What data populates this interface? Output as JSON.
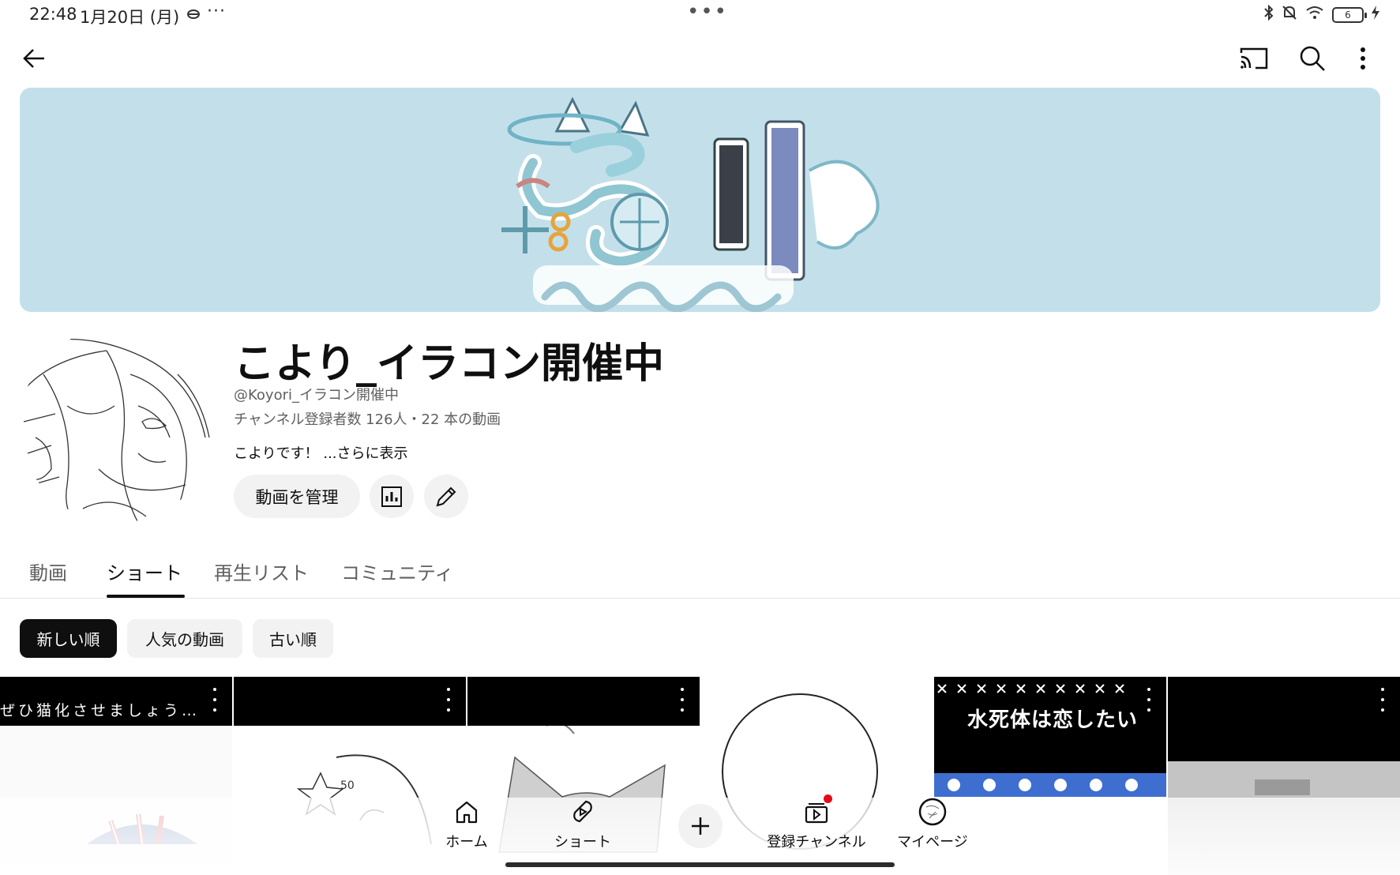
{
  "status_bar": {
    "time": "22:48",
    "date": "1月20日 (月)",
    "more_dots": "···",
    "center_dots": "•••",
    "battery_level": "6"
  },
  "top_bar": {
    "back_icon": "arrow-left-icon",
    "cast_icon": "cast-icon",
    "search_icon": "search-icon",
    "menu_icon": "more-vert-icon"
  },
  "banner": {
    "background_color": "#c3e0ea"
  },
  "channel": {
    "name": "こより_イラコン開催中",
    "handle": "@Koyori_イラコン開催中",
    "stats": "チャンネル登録者数 126人・22 本の動画",
    "description": "こよりです！",
    "more_label": " ...さらに表示",
    "manage_button": "動画を管理",
    "analytics_icon": "bar-chart-icon",
    "edit_icon": "pencil-icon"
  },
  "tabs": [
    {
      "label": "動画",
      "active": false
    },
    {
      "label": "ショート",
      "active": true
    },
    {
      "label": "再生リスト",
      "active": false
    },
    {
      "label": "コミュニティ",
      "active": false
    }
  ],
  "filters": [
    {
      "label": "新しい順",
      "active": true
    },
    {
      "label": "人気の動画",
      "active": false
    },
    {
      "label": "古い順",
      "active": false
    }
  ],
  "shorts": [
    {
      "caption": "ぜひ猫化させましょう…"
    },
    {
      "caption": ""
    },
    {
      "caption": ""
    },
    {
      "caption": ""
    },
    {
      "caption": "水死体は恋したい"
    },
    {
      "caption": ""
    }
  ],
  "bottom_nav": {
    "home": "ホーム",
    "shorts": "ショート",
    "create_icon": "plus-icon",
    "subscriptions": "登録チャンネル",
    "you": "マイページ"
  },
  "colors": {
    "accent": "#0f0f0f",
    "notification": "#e30a17"
  }
}
